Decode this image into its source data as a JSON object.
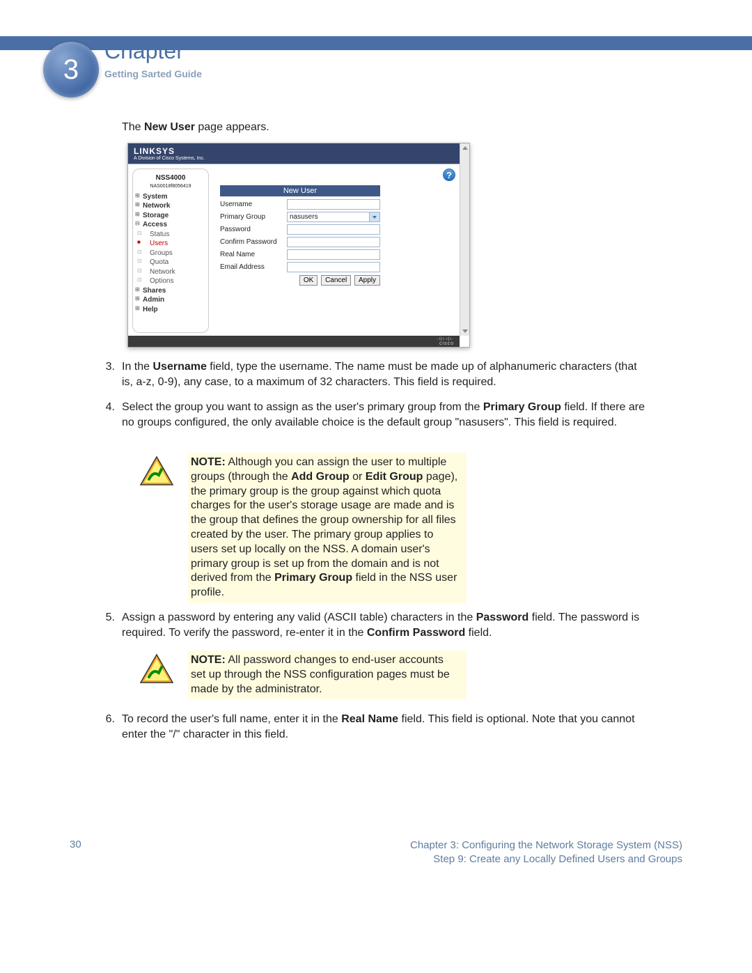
{
  "chapter": {
    "number": "3",
    "label": "Chapter",
    "subtitle": "Getting Sarted Guide"
  },
  "intro": {
    "prefix": "The ",
    "bold": "New User",
    "suffix": " page appears."
  },
  "screenshot": {
    "logo": "LINKSYS",
    "logo_sub": "A Division of Cisco Systems, Inc.",
    "model": "NSS4000",
    "serial": "NAS0018f8056419",
    "help": "?",
    "nav": {
      "system": "System",
      "network": "Network",
      "storage": "Storage",
      "access": "Access",
      "status": "Status",
      "users": "Users",
      "groups": "Groups",
      "quota": "Quota",
      "network2": "Network",
      "options": "Options",
      "shares": "Shares",
      "admin": "Admin",
      "help": "Help"
    },
    "panel_title": "New User",
    "fields": {
      "username": "Username",
      "primary_group": "Primary Group",
      "primary_group_value": "nasusers",
      "password": "Password",
      "confirm_password": "Confirm Password",
      "real_name": "Real Name",
      "email": "Email Address"
    },
    "buttons": {
      "ok": "OK",
      "cancel": "Cancel",
      "apply": "Apply"
    },
    "footer_brand": "cisco"
  },
  "steps": {
    "s3": {
      "num": "3.",
      "p1a": "In the ",
      "p1b": "Username",
      "p1c": " field, type the username. The name must be made up of alphanumeric characters (that is, a-z, 0-9), any case, to a maximum of 32 characters. This field is required."
    },
    "s4": {
      "num": "4.",
      "p1a": "Select the group you want to assign as the user's primary group from the ",
      "p1b": "Primary Group",
      "p1c": " field. If there are no groups configured, the only available choice is the default group \"nasusers\". This field is required."
    },
    "s5": {
      "num": "5.",
      "p1a": "Assign a password by entering any valid (ASCII table) characters in the ",
      "p1b": "Password",
      "p1c": " field. The password is required. To verify the password, re-enter it in the ",
      "p1d": "Confirm Password",
      "p1e": " field."
    },
    "s6": {
      "num": "6.",
      "p1a": "To record the user's full name, enter it in the ",
      "p1b": "Real Name",
      "p1c": " field. This field is optional. Note that you cannot enter the \"/\" character in this field."
    }
  },
  "notes": {
    "n1": {
      "a": "NOTE:",
      "b": " Although you can assign the user to multiple groups (through the ",
      "c": "Add Group",
      "d": " or ",
      "e": "Edit Group",
      "f": " page), the primary group is the group against which quota charges for the user's storage usage are made and is the group that defines the group ownership for all files created by the user. The primary group applies to users set up locally on the NSS. A domain user's primary group is set up from the domain and is not derived from the ",
      "g": "Primary Group",
      "h": " field in the NSS user profile."
    },
    "n2": {
      "a": "NOTE:",
      "b": " All password changes to end-user accounts set up through the NSS configuration pages must be made by the administrator."
    }
  },
  "footer": {
    "page": "30",
    "line1": "Chapter 3: Configuring the Network Storage System (NSS)",
    "line2": "Step 9: Create any Locally Defined Users and Groups"
  }
}
